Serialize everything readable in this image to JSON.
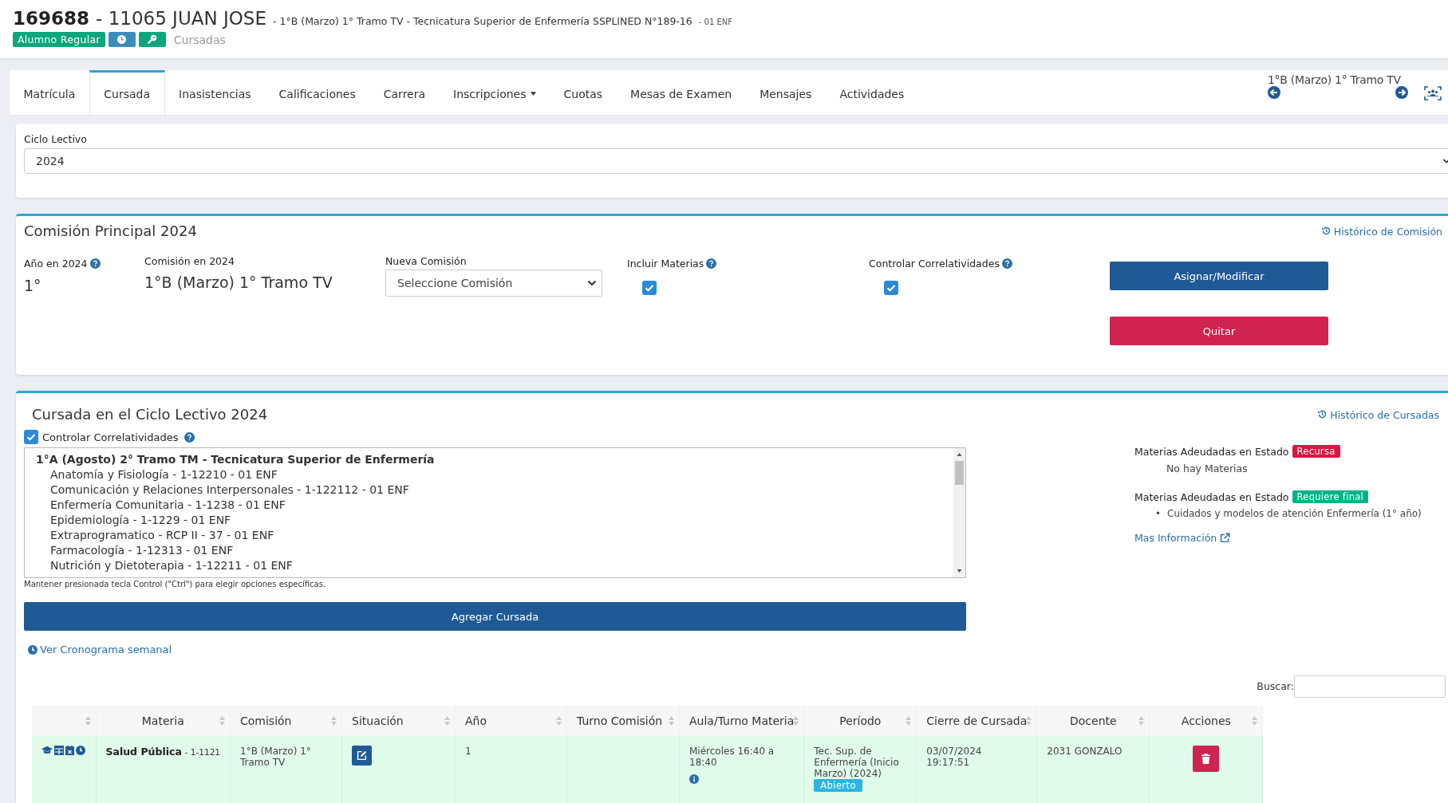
{
  "header": {
    "student_id": "169688",
    "name": "- 11065 JUAN JOSE",
    "subtitle": "- 1°B (Marzo) 1° Tramo TV - Tecnicatura Superior de Enfermería SSPLINED N°189-16",
    "suffix": "- 01 ENF",
    "status_badge": "Alumno Regular",
    "section": "Cursadas"
  },
  "tabs": [
    {
      "label": "Matrícula",
      "selected": false,
      "dropdown": false
    },
    {
      "label": "Cursada",
      "selected": true,
      "dropdown": false
    },
    {
      "label": "Inasistencias",
      "selected": false,
      "dropdown": false
    },
    {
      "label": "Calificaciones",
      "selected": false,
      "dropdown": false
    },
    {
      "label": "Carrera",
      "selected": false,
      "dropdown": false
    },
    {
      "label": "Inscripciones",
      "selected": false,
      "dropdown": true
    },
    {
      "label": "Cuotas",
      "selected": false,
      "dropdown": false
    },
    {
      "label": "Mesas de Examen",
      "selected": false,
      "dropdown": false
    },
    {
      "label": "Mensajes",
      "selected": false,
      "dropdown": false
    },
    {
      "label": "Actividades",
      "selected": false,
      "dropdown": false
    }
  ],
  "commission_nav": {
    "label": "1°B (Marzo) 1° Tramo TV"
  },
  "ciclo_lectivo": {
    "label": "Ciclo Lectivo",
    "value": "2024"
  },
  "comision_principal": {
    "title": "Comisión Principal 2024",
    "history_link": "Histórico de Comisión",
    "year_label": "Año en 2024",
    "year_value": "1°",
    "comision_label": "Comisión en 2024",
    "comision_value": "1°B (Marzo) 1° Tramo TV",
    "nueva_label": "Nueva Comisión",
    "nueva_placeholder": "Seleccione Comisión",
    "incluir_label": "Incluir Materias",
    "incluir_checked": true,
    "correl_label": "Controlar Correlatividades",
    "correl_checked": true,
    "assign_button": "Asignar/Modificar",
    "remove_button": "Quitar"
  },
  "cursada": {
    "title": "Cursada en el Ciclo Lectivo 2024",
    "history_link": "Histórico de Cursadas",
    "control_label": "Controlar Correlatividades",
    "control_checked": true,
    "list_group": "1°A (Agosto) 2° Tramo TM - Tecnicatura Superior de Enfermería",
    "list_options": [
      "Anatomía y Fisiología - 1-12210 - 01 ENF",
      "Comunicación y Relaciones Interpersonales - 1-122112 - 01 ENF",
      "Enfermería Comunitaria - 1-1238 - 01 ENF",
      "Epidemiología - 1-1229 - 01 ENF",
      "Extraprogramatico - RCP II - 37 - 01 ENF",
      "Farmacología - 1-12313 - 01 ENF",
      "Nutrición y Dietoterapia - 1-12211 - 01 ENF"
    ],
    "hint": "Mantener presionada tecla Control (\"Ctrl\") para elegir opciones específicas.",
    "add_button": "Agregar Cursada",
    "schedule_link": "Ver Cronograma semanal",
    "owed": [
      {
        "label": "Materias Adeudadas en Estado",
        "badge": "Recursa",
        "color": "#dc1442",
        "empty": "No hay Materias"
      },
      {
        "label": "Materias Adeudadas en Estado",
        "badge": "Requiere final",
        "color": "#00b386",
        "items": [
          {
            "marker": "•",
            "text": "Cuidados y modelos de atención Enfermería (1° año)"
          }
        ]
      }
    ],
    "more_info": "Mas Información"
  },
  "table": {
    "search_label": "Buscar:",
    "columns": [
      "Materia",
      "Comisión",
      "Situación",
      "Año",
      "Turno Comisión",
      "Aula/Turno Materia",
      "Período",
      "Cierre de Cursada",
      "Docente",
      "Acciones"
    ],
    "rows": [
      {
        "materia": "Salud Pública",
        "code": "- 1-1121",
        "comision": "1°B (Marzo) 1° Tramo TV",
        "ano": "1",
        "aula": "Miércoles 16:40 a 18:40",
        "periodo": "Tec. Sup. de Enfermería (Inicio Marzo) (2024)",
        "periodo_badge": "Abierto",
        "cierre": "03/07/2024 19:17:51",
        "docente": "2031 GONZALO"
      }
    ]
  }
}
